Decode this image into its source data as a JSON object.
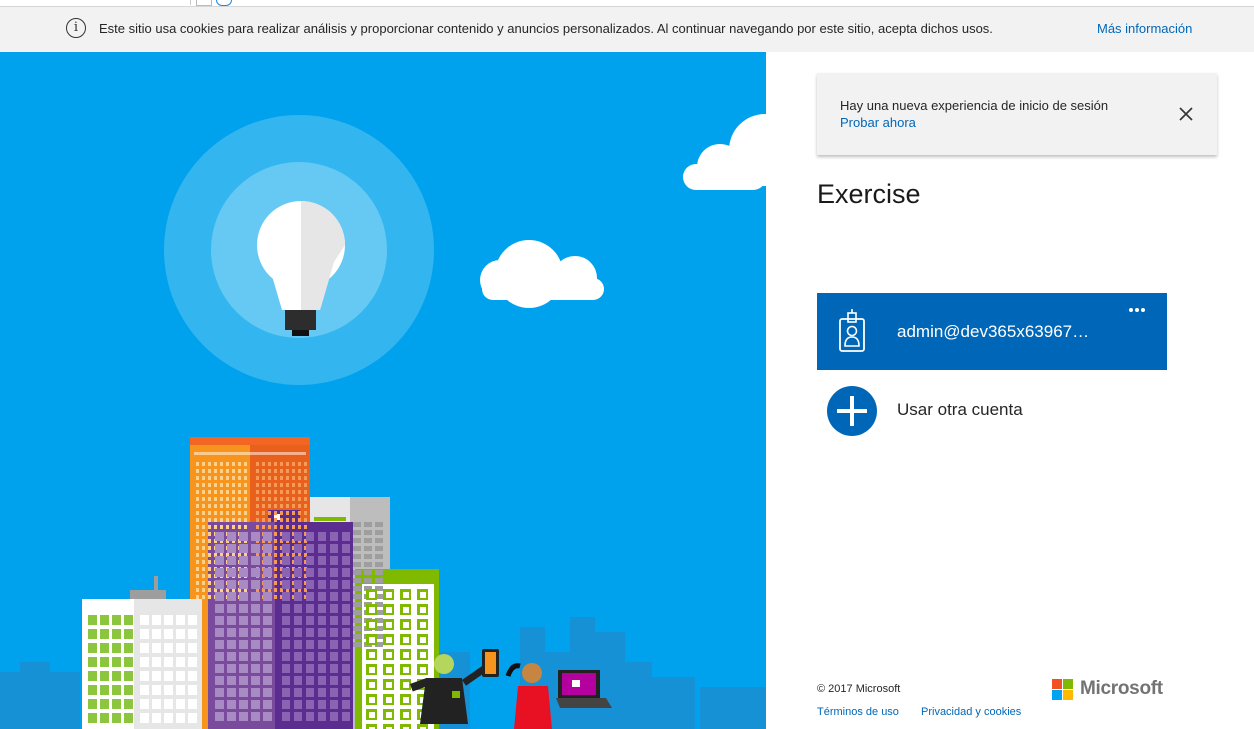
{
  "cookie_bar": {
    "icon": "info-icon",
    "text": "Este sitio usa cookies para realizar análisis y proporcionar contenido y anuncios personalizados. Al continuar navegando por este sitio, acepta dichos usos.",
    "more_link": "Más información"
  },
  "notice": {
    "text": "Hay una nueva experiencia de inicio de sesión",
    "link": "Probar ahora",
    "close_icon": "close-icon"
  },
  "page": {
    "title": "Exercise"
  },
  "accounts": [
    {
      "name": "admin@dev365x63967…",
      "icon": "badge-icon",
      "menu_icon": "more-icon"
    }
  ],
  "other_account": {
    "label": "Usar otra cuenta",
    "icon": "plus-icon"
  },
  "footer": {
    "copyright": "© 2017 Microsoft",
    "links": [
      "Términos de uso",
      "Privacidad y cookies"
    ],
    "logo_text": "Microsoft"
  },
  "colors": {
    "accent": "#0067b8",
    "hero_background": "#00a2ed",
    "logo_red": "#f25022",
    "logo_green": "#7fba00",
    "logo_blue": "#00a4ef",
    "logo_yellow": "#ffb900"
  }
}
